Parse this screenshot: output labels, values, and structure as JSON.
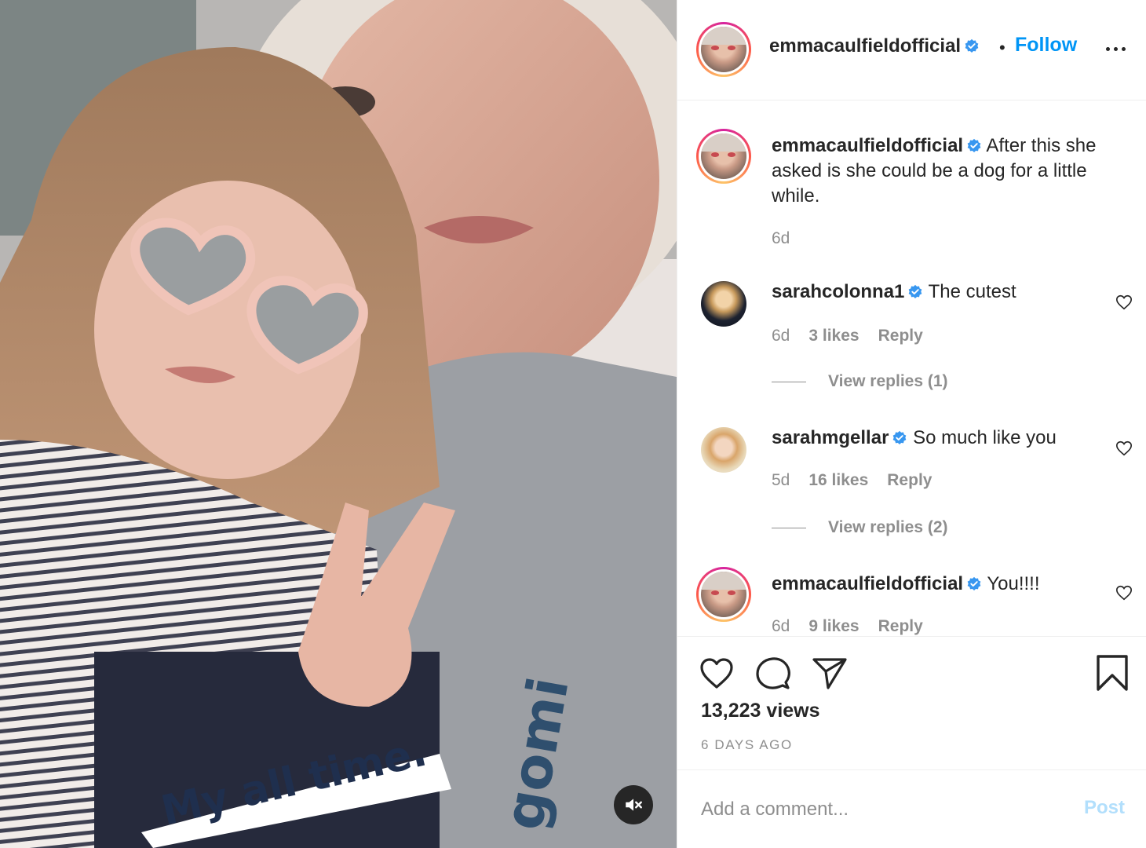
{
  "media": {
    "overlay_text": "My all time."
  },
  "header": {
    "username": "emmacaulfieldofficial",
    "separator": "•",
    "follow_label": "Follow"
  },
  "caption": {
    "username": "emmacaulfieldofficial",
    "text": "After this she asked is she could be a dog for a little while.",
    "time": "6d"
  },
  "comments": [
    {
      "username": "sarahcolonna1",
      "text": "The cutest",
      "time": "6d",
      "likes": "3 likes",
      "reply_label": "Reply",
      "view_replies": "View replies (1)"
    },
    {
      "username": "sarahmgellar",
      "text": "So much like you",
      "time": "5d",
      "likes": "16 likes",
      "reply_label": "Reply",
      "view_replies": "View replies (2)"
    },
    {
      "username": "emmacaulfieldofficial",
      "text": "You!!!!",
      "time": "6d",
      "likes": "9 likes",
      "reply_label": "Reply"
    }
  ],
  "stats": {
    "views": "13,223 views",
    "date": "6 DAYS AGO"
  },
  "composer": {
    "placeholder": "Add a comment...",
    "post_label": "Post"
  },
  "icons": {
    "like": "heart-icon",
    "comment": "comment-icon",
    "share": "paper-plane-icon",
    "save": "bookmark-icon",
    "more": "more-options-icon",
    "mute": "muted-speaker-icon",
    "verified": "verified-badge-icon"
  },
  "colors": {
    "accent": "#0095f6",
    "verified": "#3897f0",
    "muted_text": "#8e8e8e",
    "post_disabled": "#b2dffc"
  }
}
